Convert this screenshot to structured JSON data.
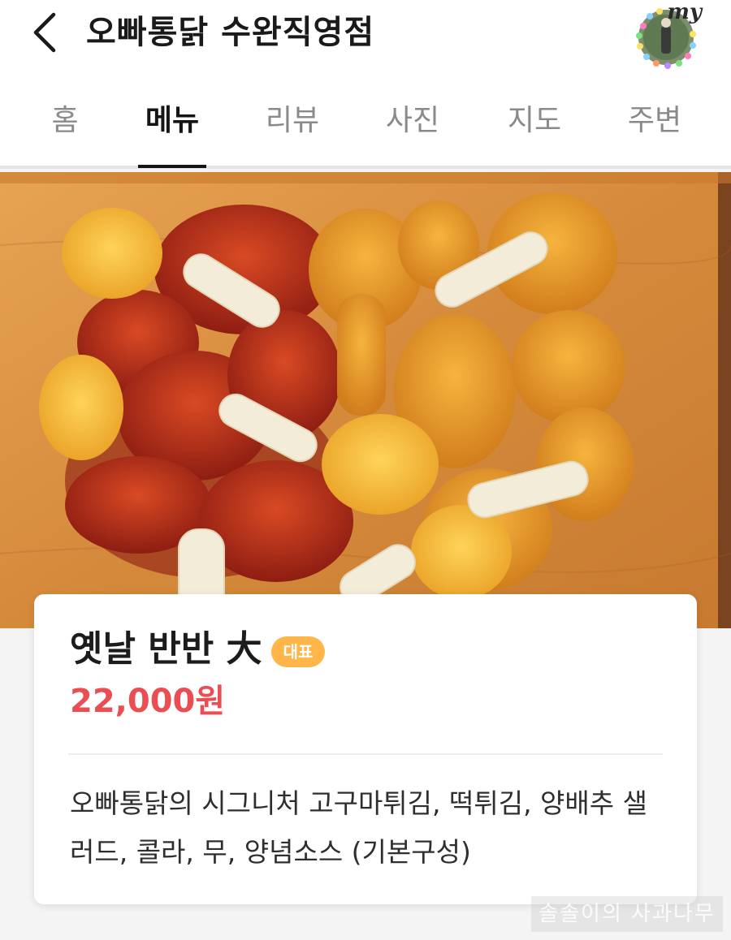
{
  "header": {
    "title": "오빠통닭 수완직영점",
    "back_icon": "chevron-left-icon",
    "profile_badge": "my"
  },
  "tabs": [
    {
      "label": "홈"
    },
    {
      "label": "메뉴"
    },
    {
      "label": "리뷰"
    },
    {
      "label": "사진"
    },
    {
      "label": "지도"
    },
    {
      "label": "주변"
    }
  ],
  "active_tab": "메뉴",
  "menu_item": {
    "name": "옛날 반반 大",
    "badge": "대표",
    "price": "22,000원",
    "description": "오빠통닭의 시그니처 고구마튀김, 떡튀김, 양배추 샐러드, 콜라, 무, 양념소스 (기본구성)"
  },
  "watermark": "솔솔이의 사과나무",
  "colors": {
    "price": "#ea4d52",
    "badge": "#ffb547",
    "active_tab": "#151515",
    "inactive_tab": "#8a8a8a"
  }
}
